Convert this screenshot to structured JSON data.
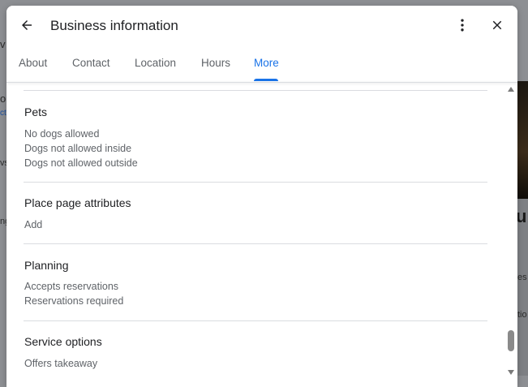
{
  "dialog": {
    "title": "Business information",
    "back_icon": "arrow-left-icon",
    "more_icon": "more-vert-icon",
    "close_icon": "close-icon"
  },
  "tabs": [
    {
      "label": "About",
      "active": false
    },
    {
      "label": "Contact",
      "active": false
    },
    {
      "label": "Location",
      "active": false
    },
    {
      "label": "Hours",
      "active": false
    },
    {
      "label": "More",
      "active": true
    }
  ],
  "sections": [
    {
      "title": "Pets",
      "items": [
        "No dogs allowed",
        "Dogs not allowed inside",
        "Dogs not allowed outside"
      ]
    },
    {
      "title": "Place page attributes",
      "items": [
        "Add"
      ]
    },
    {
      "title": "Planning",
      "items": [
        "Accepts reservations",
        "Reservations required"
      ]
    },
    {
      "title": "Service options",
      "items": [
        "Offers takeaway"
      ]
    }
  ],
  "background_fragments": [
    "v",
    "or",
    "ct",
    "vs",
    "ng",
    "ub",
    "es",
    "tio"
  ],
  "colors": {
    "accent": "#1a73e8",
    "title_text": "#202124",
    "secondary_text": "#5f6368",
    "divider": "#dadce0",
    "backdrop": "#8d8f93"
  }
}
